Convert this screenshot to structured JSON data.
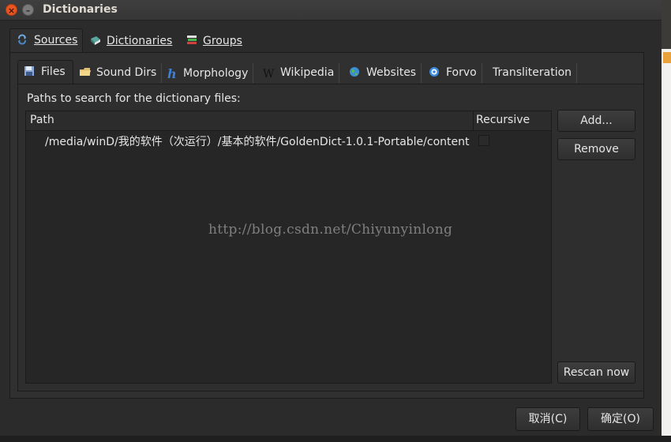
{
  "window": {
    "title": "Dictionaries"
  },
  "outer_tabs": [
    {
      "label": "Sources",
      "icon": "refresh-icon",
      "active": true
    },
    {
      "label": "Dictionaries",
      "icon": "book-icon",
      "active": false
    },
    {
      "label": "Groups",
      "icon": "books-stack-icon",
      "active": false
    }
  ],
  "inner_tabs": [
    {
      "label": "Files",
      "icon": "floppy-icon",
      "active": true
    },
    {
      "label": "Sound Dirs",
      "icon": "folder-icon",
      "active": false
    },
    {
      "label": "Morphology",
      "icon": "hunspell-h-icon",
      "active": false
    },
    {
      "label": "Wikipedia",
      "icon": "wikipedia-w-icon",
      "active": false
    },
    {
      "label": "Websites",
      "icon": "globe-icon",
      "active": false
    },
    {
      "label": "Forvo",
      "icon": "forvo-icon",
      "active": false
    },
    {
      "label": "Transliteration",
      "icon": "",
      "active": false
    }
  ],
  "files": {
    "label": "Paths to search for the dictionary files:",
    "columns": [
      "Path",
      "Recursive"
    ],
    "rows": [
      {
        "path": "/media/winD/我的软件（次运行）/基本的软件/GoldenDict-1.0.1-Portable/content",
        "recursive": false
      }
    ],
    "buttons": {
      "add": "Add...",
      "remove": "Remove",
      "rescan": "Rescan now"
    }
  },
  "dialog_buttons": {
    "cancel": "取消(C)",
    "ok": "确定(O)"
  },
  "watermark": "http://blog.csdn.net/Chiyunyinlong",
  "colors": {
    "accent": "#e95420",
    "background": "#2b2b2b"
  }
}
